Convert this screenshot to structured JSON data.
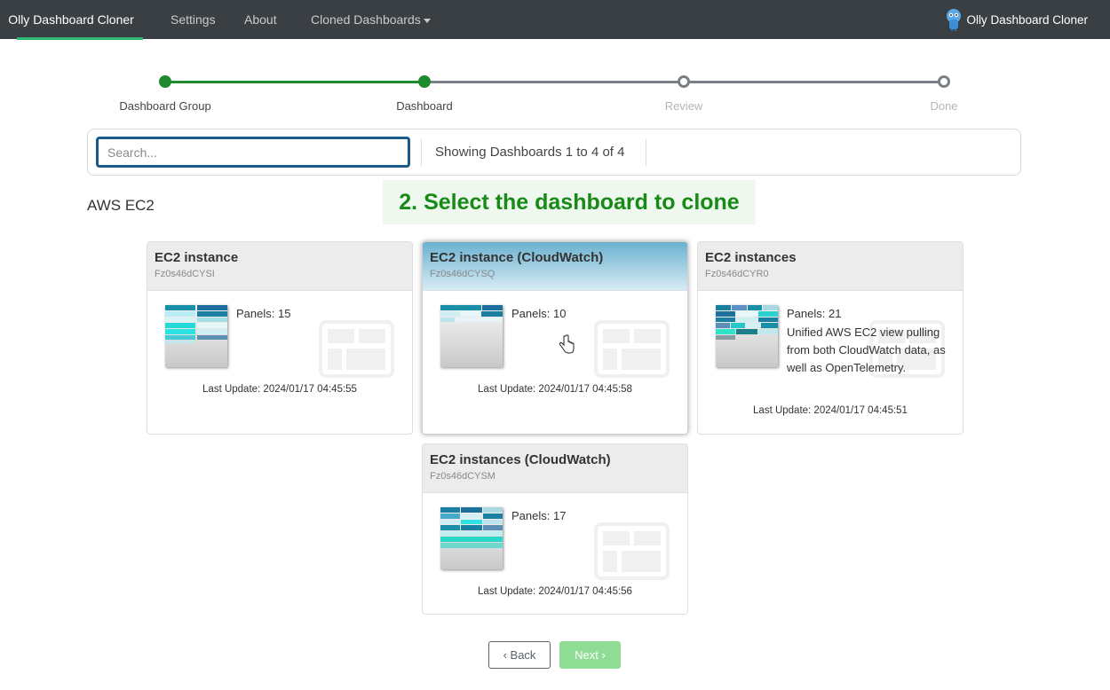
{
  "nav": {
    "brand": "Olly Dashboard Cloner",
    "items": [
      "Settings",
      "About",
      "Cloned Dashboards"
    ],
    "right_title": "Olly Dashboard Cloner",
    "accent": "#2eb872"
  },
  "stepper": {
    "steps": [
      {
        "label": "Dashboard Group",
        "status": "complete"
      },
      {
        "label": "Dashboard",
        "status": "complete"
      },
      {
        "label": "Review",
        "status": "incomplete"
      },
      {
        "label": "Done",
        "status": "incomplete"
      }
    ]
  },
  "search": {
    "placeholder": "Search...",
    "value": "",
    "showing": "Showing Dashboards 1 to 4 of 4"
  },
  "banner": "2. Select the dashboard to clone",
  "group_title": "AWS EC2",
  "cards": [
    {
      "title": "EC2 instance",
      "uid": "Fz0s46dCYSI",
      "panels": "Panels: 15",
      "description": "",
      "last_update": "Last Update: 2024/01/17 04:45:55",
      "selected": false
    },
    {
      "title": "EC2 instance (CloudWatch)",
      "uid": "Fz0s46dCYSQ",
      "panels": "Panels: 10",
      "description": "",
      "last_update": "Last Update: 2024/01/17 04:45:58",
      "selected": true
    },
    {
      "title": "EC2 instances",
      "uid": "Fz0s46dCYR0",
      "panels": "Panels: 21",
      "description": "Unified AWS EC2 view pulling from both CloudWatch data, as well as OpenTelemetry.",
      "last_update": "Last Update: 2024/01/17 04:45:51",
      "selected": false
    },
    {
      "title": "EC2 instances (CloudWatch)",
      "uid": "Fz0s46dCYSM",
      "panels": "Panels: 17",
      "description": "",
      "last_update": "Last Update: 2024/01/17 04:45:56",
      "selected": false
    }
  ],
  "buttons": {
    "back": "Back",
    "next": "Next"
  }
}
